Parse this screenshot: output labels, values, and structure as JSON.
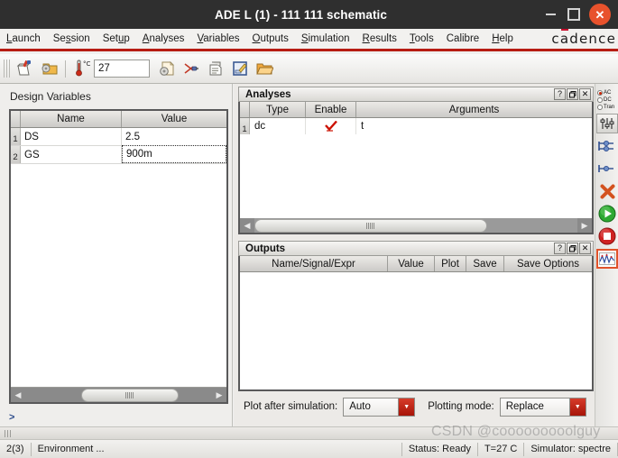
{
  "window": {
    "title": "ADE L (1) - 111 111 schematic",
    "minimize_label": "–",
    "maximize_label": "□",
    "close_label": "✕"
  },
  "menubar": {
    "items": [
      {
        "pre": "",
        "mn": "L",
        "post": "aunch"
      },
      {
        "pre": "Se",
        "mn": "s",
        "post": "sion"
      },
      {
        "pre": "Set",
        "mn": "u",
        "post": "p"
      },
      {
        "pre": "",
        "mn": "A",
        "post": "nalyses"
      },
      {
        "pre": "",
        "mn": "V",
        "post": "ariables"
      },
      {
        "pre": "",
        "mn": "O",
        "post": "utputs"
      },
      {
        "pre": "",
        "mn": "S",
        "post": "imulation"
      },
      {
        "pre": "",
        "mn": "R",
        "post": "esults"
      },
      {
        "pre": "",
        "mn": "T",
        "post": "ools"
      },
      {
        "pre": "Calibre",
        "mn": "",
        "post": ""
      },
      {
        "pre": "",
        "mn": "H",
        "post": "elp"
      }
    ],
    "brand_1": "c",
    "brand_a": "a",
    "brand_2": "dence"
  },
  "toolbar": {
    "temperature_value": "27",
    "temperature_unit": "°C",
    "icons": [
      "new-session-icon",
      "open-session-icon",
      "temperature-icon",
      "save-state-icon",
      "delete-analyses-icon",
      "netlist-icon",
      "edit-variables-icon",
      "open-results-icon"
    ]
  },
  "design_variables": {
    "title": "Design Variables",
    "columns": [
      "Name",
      "Value"
    ],
    "rows": [
      {
        "num": "1",
        "name": "DS",
        "value": "2.5",
        "focused": false
      },
      {
        "num": "2",
        "name": "GS",
        "value": "900m",
        "focused": true
      }
    ],
    "prompt": ">"
  },
  "analyses": {
    "title": "Analyses",
    "help_label": "?",
    "undock_label": "❐",
    "close_label": "✕",
    "columns": [
      "Type",
      "Enable",
      "Arguments"
    ],
    "rows": [
      {
        "num": "1",
        "type": "dc",
        "enable": true,
        "arguments": "t"
      }
    ]
  },
  "outputs": {
    "title": "Outputs",
    "help_label": "?",
    "undock_label": "❐",
    "close_label": "✕",
    "columns": [
      "Name/Signal/Expr",
      "Value",
      "Plot",
      "Save",
      "Save Options"
    ],
    "rows": []
  },
  "plot_controls": {
    "plot_after_label": "Plot after simulation:",
    "plot_after_value": "Auto",
    "plotting_mode_label": "Plotting mode:",
    "plotting_mode_value": "Replace",
    "arrow_glyph": "▼"
  },
  "icon_strip": {
    "radios": [
      {
        "label": "AC",
        "selected": true
      },
      {
        "label": "DC",
        "selected": false
      },
      {
        "label": "Tran",
        "selected": false
      }
    ],
    "buttons": [
      "choose-analyses-icon",
      "edit-variables-icon",
      "setup-outputs-icon",
      "delete-icon",
      "run-simulation-icon",
      "stop-simulation-icon",
      "plot-outputs-icon"
    ]
  },
  "statusbar": {
    "counter": "2(3)",
    "environment": "Environment ...",
    "status": "Status: Ready",
    "temperature": "T=27  C",
    "simulator": "Simulator: spectre"
  },
  "watermark": {
    "text": "CSDN @cooooooooolguy"
  },
  "colors": {
    "accent_red": "#b71c13",
    "close_orange": "#e8522c",
    "check_red": "#cc1100",
    "selection_orange": "#e0522a"
  }
}
